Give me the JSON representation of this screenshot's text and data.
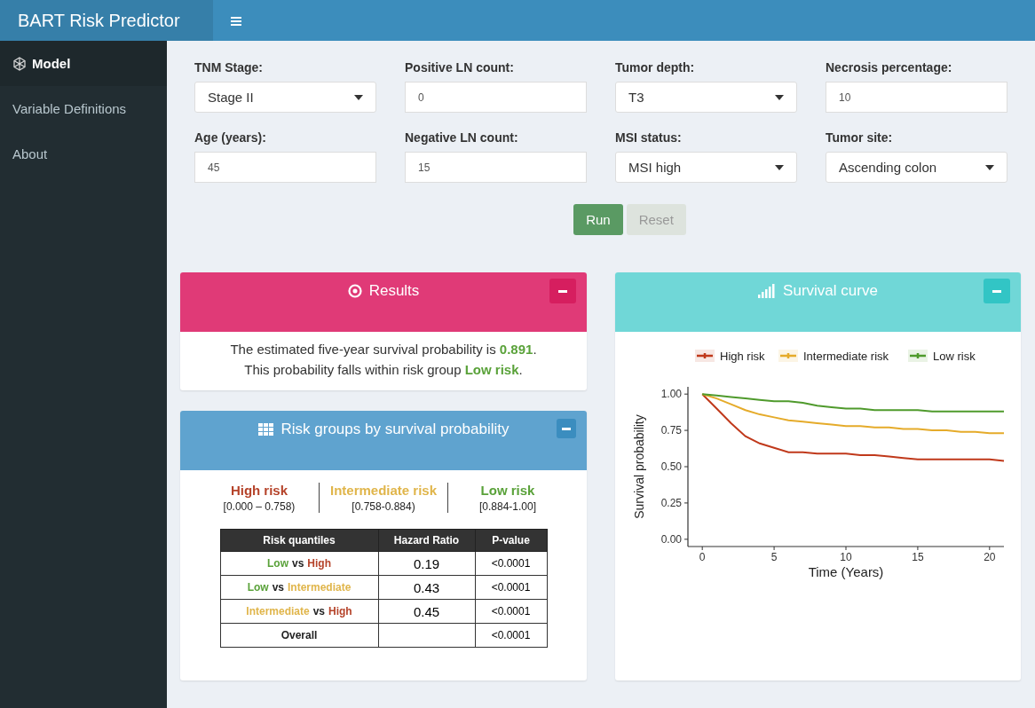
{
  "header": {
    "title": "BART Risk Predictor"
  },
  "sidebar": {
    "items": [
      {
        "label": "Model",
        "selected": true,
        "icon": true
      },
      {
        "label": "Variable Definitions",
        "selected": false,
        "icon": false
      },
      {
        "label": "About",
        "selected": false,
        "icon": false
      }
    ]
  },
  "form": {
    "fields": [
      {
        "label": "TNM Stage:",
        "kind": "select",
        "value": "Stage II"
      },
      {
        "label": "Positive LN count:",
        "kind": "number",
        "value": "0"
      },
      {
        "label": "Tumor depth:",
        "kind": "select",
        "value": "T3"
      },
      {
        "label": "Necrosis percentage:",
        "kind": "number",
        "value": "10"
      },
      {
        "label": "Age (years):",
        "kind": "number",
        "value": "45"
      },
      {
        "label": "Negative LN count:",
        "kind": "number",
        "value": "15"
      },
      {
        "label": "MSI status:",
        "kind": "select",
        "value": "MSI high"
      },
      {
        "label": "Tumor site:",
        "kind": "select",
        "value": "Ascending colon"
      }
    ],
    "buttons": [
      {
        "label": "Run",
        "disabled": false
      },
      {
        "label": "Reset",
        "disabled": true
      }
    ]
  },
  "results": {
    "title": "Results",
    "lines": [
      "The estimated five-year survival probability is **0.891**.",
      "This probability falls within risk group **Low risk**."
    ]
  },
  "risk_groups": {
    "title": "Risk groups by survival probability",
    "groups": [
      {
        "name": "High risk",
        "range": "[0.000 – 0.758)",
        "color": "#b5432a"
      },
      {
        "name": "Intermediate risk",
        "range": "[0.758-0.884)",
        "color": "#e0b54a"
      },
      {
        "name": "Low risk",
        "range": "[0.884-1.00]",
        "color": "#5aa23a"
      }
    ],
    "table": {
      "columns": [
        "Risk quantiles",
        "Hazard Ratio",
        "P-value"
      ],
      "rows": [
        {
          "comparison": [
            {
              "text": "Low",
              "color": "#5aa23a"
            },
            {
              "text": "vs"
            },
            {
              "text": "High",
              "color": "#b5432a"
            }
          ],
          "hazard_ratio": "0.19",
          "p_value": "<0.0001"
        },
        {
          "comparison": [
            {
              "text": "Low",
              "color": "#5aa23a"
            },
            {
              "text": "vs"
            },
            {
              "text": "Intermediate",
              "color": "#e0b54a"
            }
          ],
          "hazard_ratio": "0.43",
          "p_value": "<0.0001"
        },
        {
          "comparison": [
            {
              "text": "Intermediate",
              "color": "#e0b54a"
            },
            {
              "text": "vs"
            },
            {
              "text": "High",
              "color": "#b5432a"
            }
          ],
          "hazard_ratio": "0.45",
          "p_value": "<0.0001"
        },
        {
          "comparison": [
            {
              "text": "Overall"
            }
          ],
          "p_value": "<0.0001"
        }
      ]
    }
  },
  "survival": {
    "title": "Survival curve",
    "chart_data": {
      "type": "line",
      "xlabel": "Time (Years)",
      "ylabel": "Survival probability",
      "x": [
        0,
        1,
        2,
        3,
        4,
        5,
        6,
        7,
        8,
        9,
        10,
        11,
        12,
        13,
        14,
        15,
        16,
        17,
        18,
        19,
        20,
        21
      ],
      "series": [
        {
          "name": "High risk",
          "color": "#c0391b",
          "values": [
            1,
            0.9,
            0.8,
            0.71,
            0.66,
            0.63,
            0.6,
            0.6,
            0.59,
            0.59,
            0.59,
            0.58,
            0.58,
            0.57,
            0.56,
            0.55,
            0.55,
            0.55,
            0.55,
            0.55,
            0.55,
            0.54
          ]
        },
        {
          "name": "Intermediate risk",
          "color": "#e5ab2a",
          "values": [
            1,
            0.97,
            0.93,
            0.89,
            0.86,
            0.84,
            0.82,
            0.81,
            0.8,
            0.79,
            0.78,
            0.78,
            0.77,
            0.77,
            0.76,
            0.76,
            0.75,
            0.75,
            0.74,
            0.74,
            0.73,
            0.73
          ]
        },
        {
          "name": "Low risk",
          "color": "#4f9a2c",
          "values": [
            1,
            0.99,
            0.98,
            0.97,
            0.96,
            0.95,
            0.95,
            0.94,
            0.92,
            0.91,
            0.9,
            0.9,
            0.89,
            0.89,
            0.89,
            0.89,
            0.88,
            0.88,
            0.88,
            0.88,
            0.88,
            0.88
          ]
        }
      ],
      "xlim": [
        -1,
        21
      ],
      "ylim": [
        -0.05,
        1.05
      ],
      "legend": true,
      "xticks": [
        {
          "value": 0,
          "label": "0"
        },
        {
          "value": 5,
          "label": "5"
        },
        {
          "value": 10,
          "label": "10"
        },
        {
          "value": 15,
          "label": "15"
        },
        {
          "value": 20,
          "label": "20"
        }
      ],
      "yticks": [
        {
          "value": 0,
          "label": "0.00"
        },
        {
          "value": 0.25,
          "label": "0.25"
        },
        {
          "value": 0.5,
          "label": "0.50"
        },
        {
          "value": 0.75,
          "label": "0.75"
        },
        {
          "value": 1,
          "label": "1.00"
        }
      ]
    }
  }
}
